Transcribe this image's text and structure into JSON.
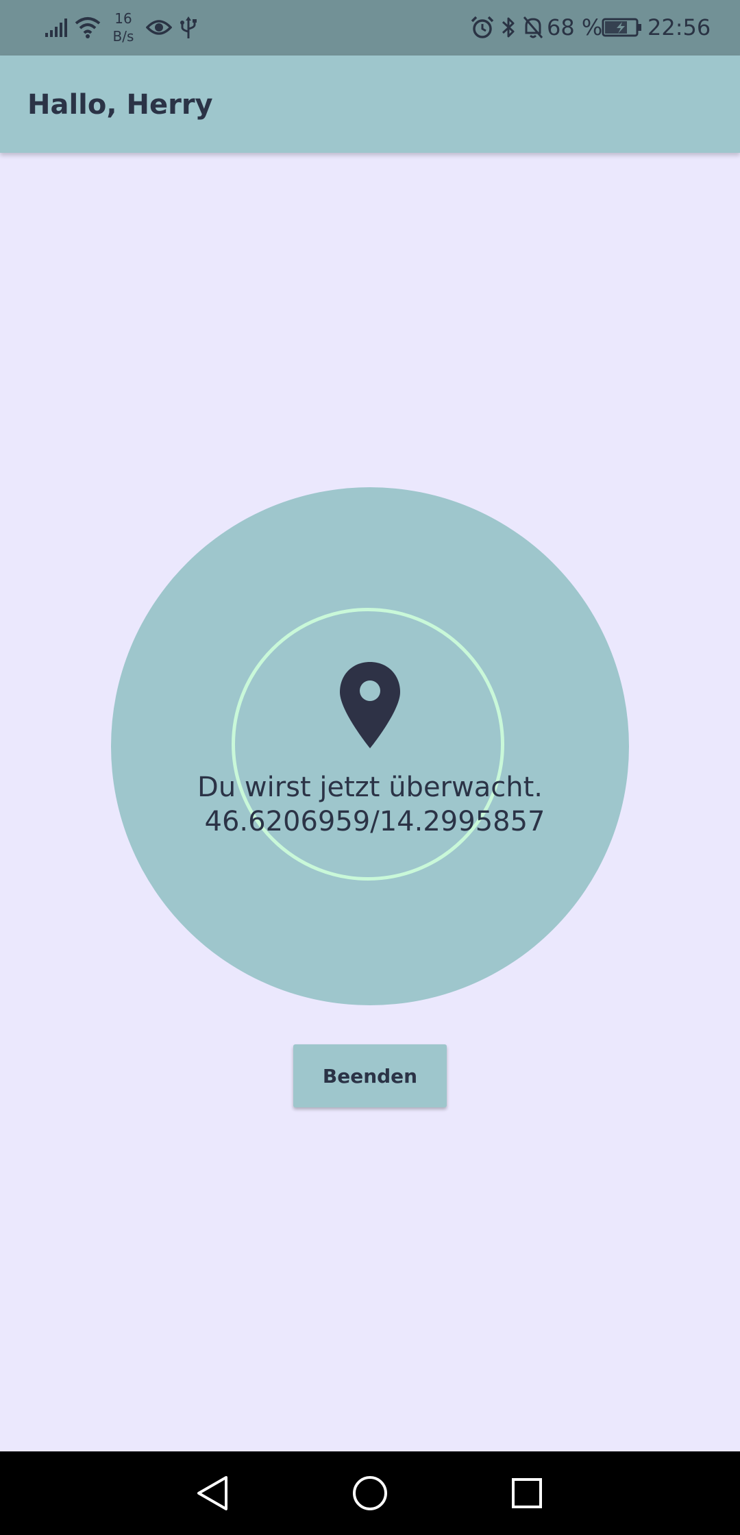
{
  "status_bar": {
    "net_speed_value": "16",
    "net_speed_unit": "B/s",
    "battery_percent": "68 %",
    "time": "22:56",
    "icons": [
      "signal-icon",
      "wifi-icon",
      "eye-icon",
      "usb-icon",
      "alarm-icon",
      "bluetooth-icon",
      "bell-off-icon",
      "battery-charging-icon"
    ]
  },
  "app_bar": {
    "title": "Hallo, Herry"
  },
  "monitor": {
    "status_text": "Du wirst jetzt überwacht.",
    "coordinates": "46.6206959/14.2995857",
    "icon": "location-pin-icon"
  },
  "actions": {
    "end_label": "Beenden"
  },
  "nav_bar": {
    "icons": [
      "back-icon",
      "home-icon",
      "recents-icon"
    ]
  },
  "colors": {
    "background": "#ebe8fd",
    "accent": "#9ec6cc",
    "status_bar": "#729196",
    "ring": "#c9f8d9",
    "text": "#2b3346"
  }
}
